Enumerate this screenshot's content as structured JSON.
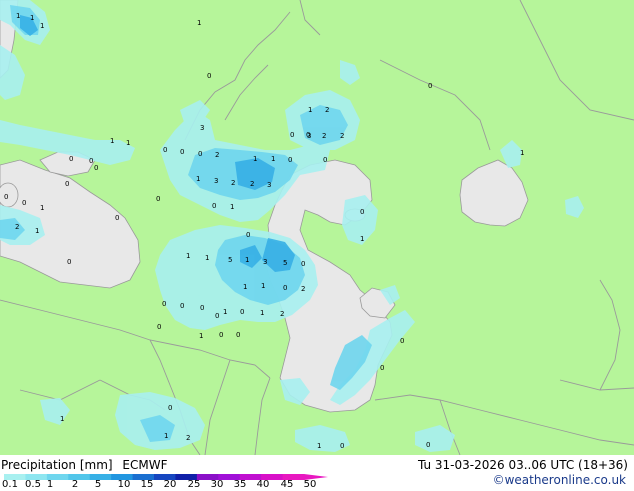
{
  "footer": {
    "title": "Precipitation [mm]",
    "model": "ECMWF",
    "run": "Tu 31-03-2026 03..06 UTC (18+36)",
    "credit": "©weatheronline.co.uk"
  },
  "scale": {
    "labels": [
      "0.1",
      "0.5",
      "1",
      "2",
      "5",
      "10",
      "15",
      "20",
      "25",
      "30",
      "35",
      "40",
      "45",
      "50"
    ],
    "colors": [
      "#a8f0f0",
      "#8ee6f0",
      "#6fd6ee",
      "#52c6ea",
      "#37b0e6",
      "#2196e0",
      "#1a6fd0",
      "#1646c0",
      "#1020a8",
      "#8a10c8",
      "#a010d8",
      "#c010d0",
      "#d810c8",
      "#e818c0"
    ]
  },
  "colors": {
    "land": "#b6f59a",
    "sea": "#e8e8e8",
    "border": "#9a9a9a",
    "precip_light": "#a8f0f0",
    "precip_mid": "#6fd6ee",
    "precip_heavy": "#37b0e6"
  },
  "map_values": [
    "1",
    "1",
    "1",
    "1",
    "0",
    "0",
    "1",
    "2",
    "3",
    "2",
    "0",
    "0",
    "1",
    "3",
    "1",
    "2",
    "0",
    "0",
    "0",
    "0",
    "0",
    "1",
    "1",
    "0",
    "0",
    "0",
    "2",
    "3",
    "2",
    "2",
    "3",
    "0",
    "1",
    "0",
    "0",
    "1",
    "0",
    "1",
    "2",
    "1",
    "5",
    "1",
    "3",
    "5",
    "0",
    "1",
    "1",
    "0",
    "2",
    "0",
    "0",
    "0",
    "1",
    "0",
    "0",
    "0",
    "0",
    "1",
    "2",
    "0",
    "0",
    "1",
    "0",
    "1",
    "0",
    "0",
    "0",
    "1",
    "1",
    "1",
    "0",
    "0",
    "0",
    "1",
    "2",
    "1",
    "1",
    "0",
    "0"
  ]
}
